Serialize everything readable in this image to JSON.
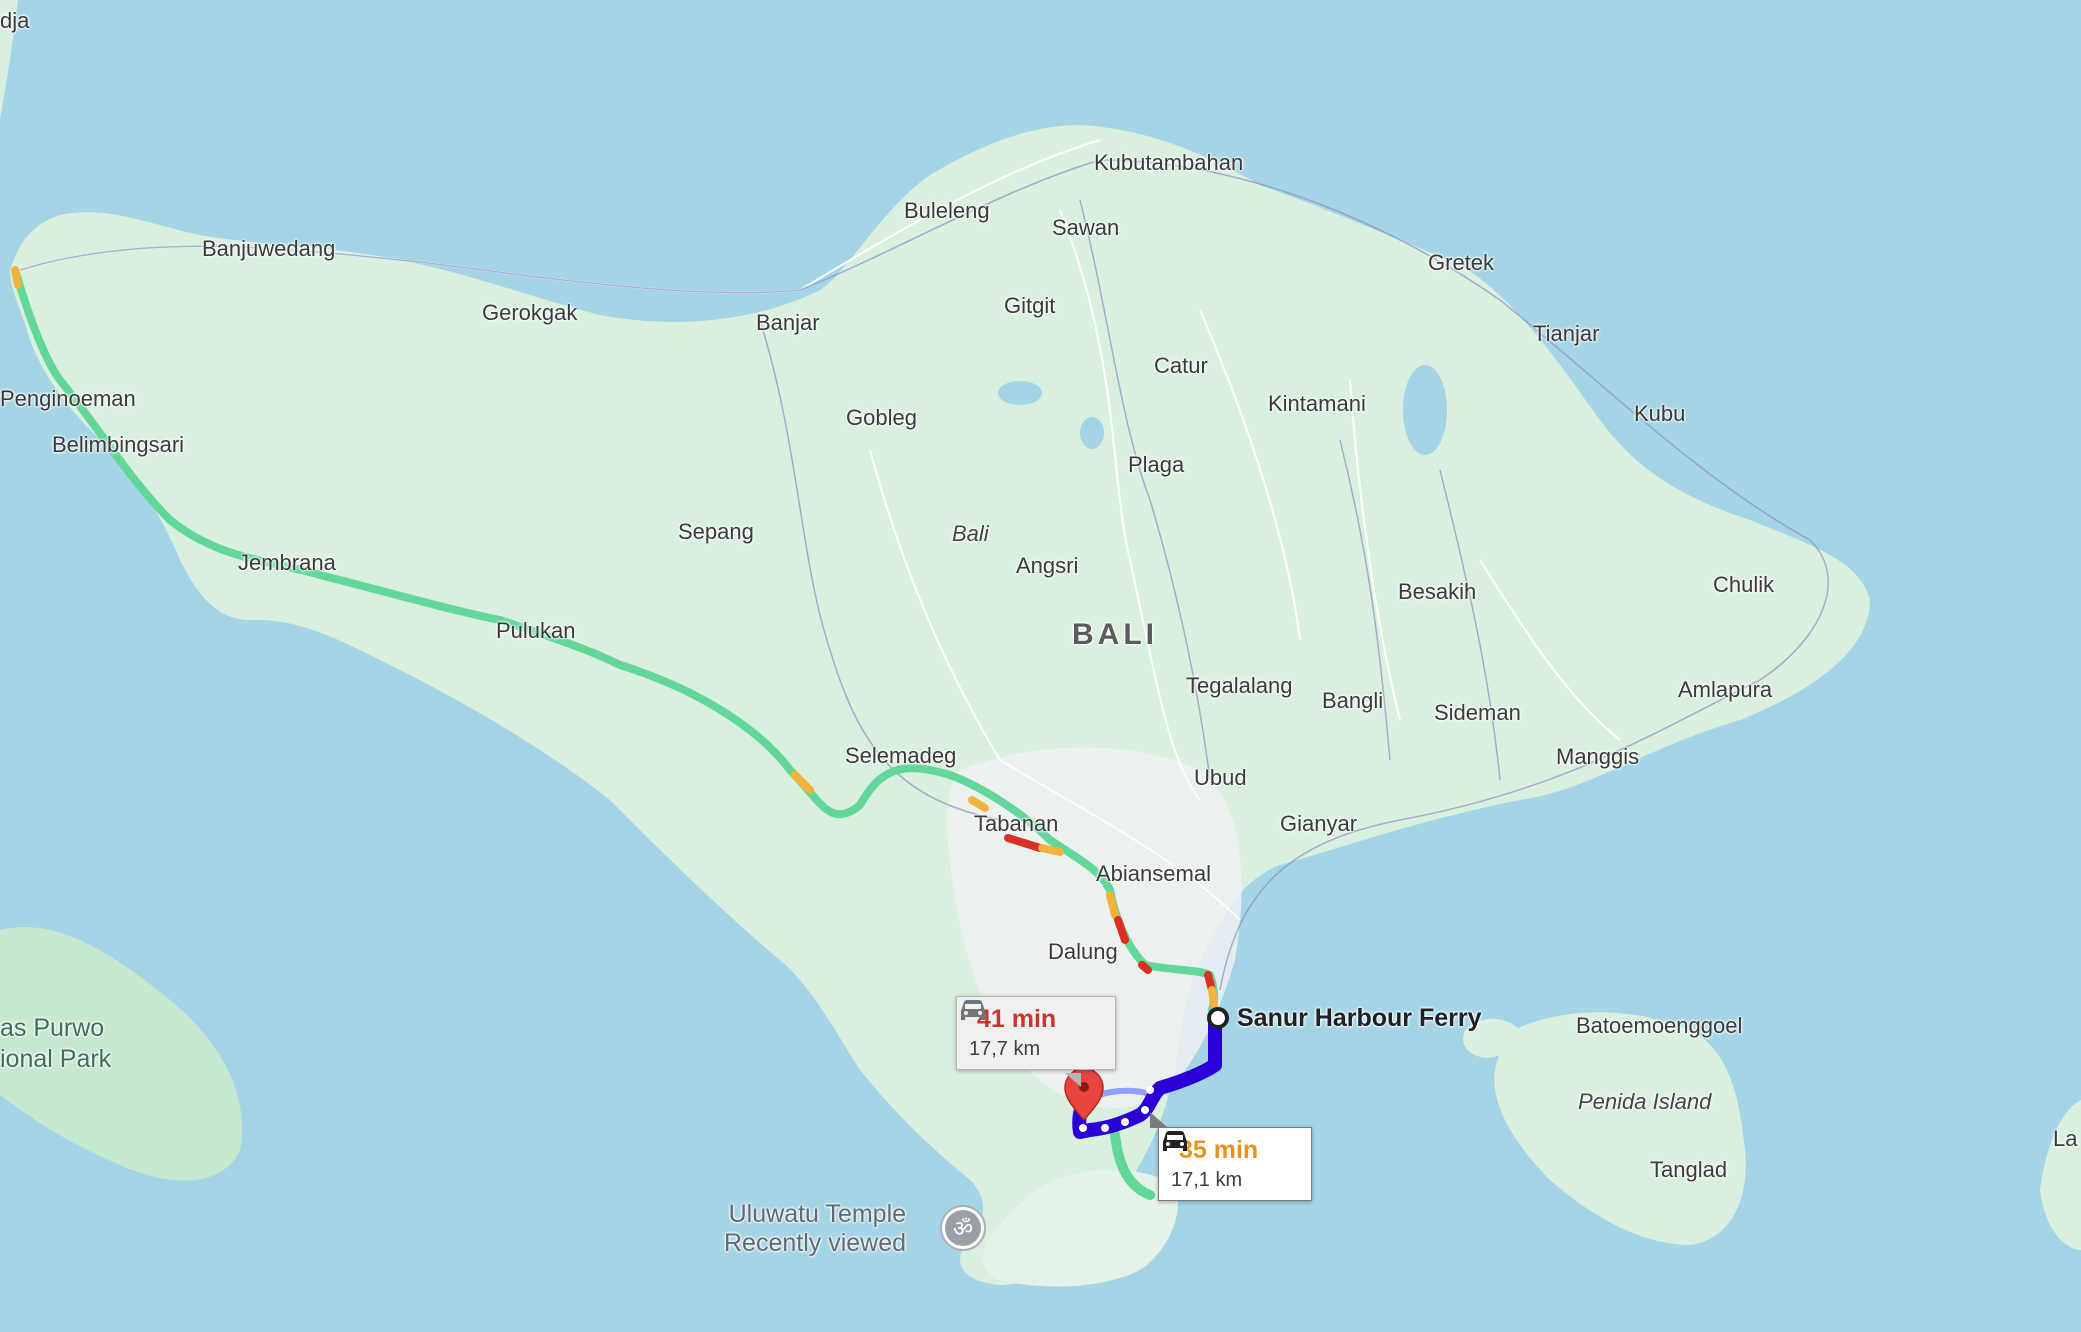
{
  "map": {
    "colors": {
      "sea": "#a4d4e6",
      "land": "#d9f0df",
      "route_primary": "#2b00d6",
      "traffic_green": "#63d79a",
      "traffic_orange": "#f2b33d",
      "traffic_red": "#d93025",
      "pin": "#e8453c",
      "time_red": "#c5372c",
      "time_orange": "#e8931b"
    },
    "region_label": "BALI",
    "italic_labels": [
      "Bali",
      "Penida Island"
    ],
    "places": [
      "dja",
      "Banjuwedang",
      "Gerokgak",
      "Penginoeman",
      "Belimbingsari",
      "Jembrana",
      "Pulukan",
      "Kubutambahan",
      "Buleleng",
      "Sawan",
      "Gitgit",
      "Banjar",
      "Gretek",
      "Tianjar",
      "Catur",
      "Kintamani",
      "Gobleg",
      "Plaga",
      "Kubu",
      "Sepang",
      "Angsri",
      "Besakih",
      "Chulik",
      "Tegalalang",
      "Bangli",
      "Sideman",
      "Amlapura",
      "Selemadeg",
      "Ubud",
      "Manggis",
      "Tabanan",
      "Gianyar",
      "Abiansemal",
      "Dalung",
      "Batoemoenggoel",
      "Tanglad",
      "La"
    ],
    "park_lines": [
      "as Purwo",
      "ional Park"
    ],
    "poi": {
      "name": "Uluwatu Temple",
      "sub": "Recently viewed",
      "icon": "om-temple-icon"
    },
    "start": {
      "name": "Sanur Harbour Ferry",
      "icon": "origin-circle-icon"
    },
    "destination": {
      "icon": "red-pin-icon"
    },
    "routes": [
      {
        "id": "alt",
        "time": "41 min",
        "distance": "17,7 km",
        "icon": "car-icon"
      },
      {
        "id": "main",
        "time": "35 min",
        "distance": "17,1 km",
        "icon": "car-icon"
      }
    ]
  }
}
